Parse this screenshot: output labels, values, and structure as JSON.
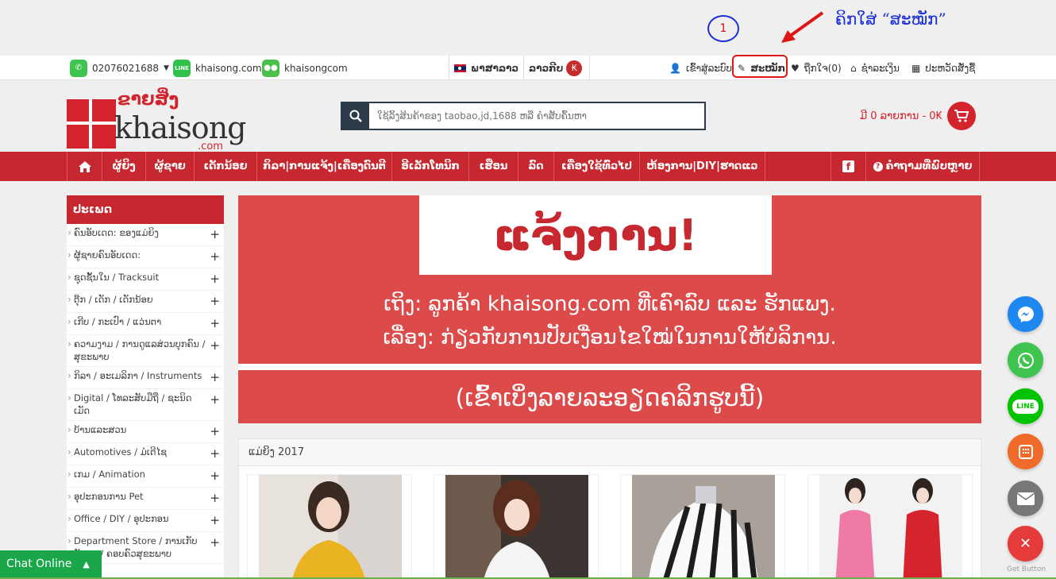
{
  "annotation": {
    "step_number": "1",
    "instruction": "ຄິກໃສ່ “ສະໝັກ”"
  },
  "topbar": {
    "phone": "02076021688",
    "line_id": "khaisong.com",
    "wechat_id": "khaisongcom",
    "language": "ພາສາລາວ",
    "currency": "ລາວກີບ",
    "currency_symbol": "₭",
    "login": "ເຂົ້າສູ່ລະບົບ",
    "register": "ສະໝັກ",
    "wishlist": "ຖືກໃຈ(0)",
    "checkout": "ຊຳລະເງິນ",
    "order_history": "ປະຫວັດສັ່ງຊື້"
  },
  "header": {
    "logo_lao": "ຂາຍສິ່ງ",
    "logo_main": "khaisong",
    "logo_com": ".com",
    "search_placeholder": "ໃຊ້ລິ້ງສິນຄ້າຂອງ taobao,jd,1688 ຫລື ຄຳສັບຄົ້ນຫາ",
    "cart_text": "ມີ 0 ລາຍການ - 0₭"
  },
  "nav": {
    "items": [
      "ຜູ້ຍິງ",
      "ຜູ້ຊາຍ",
      "ເດັກນ້ອຍ",
      "ກິລາ|ການແຈ້ງ|ເຄື່ອງດົນຕີ",
      "ອີເລັກໂທນິກ",
      "ເຮືອນ",
      "ລົດ",
      "ເຄື່ອງໃຊ້ທົ່ວໄປ",
      "ຫ້ອງການ|DIY|ຮາດແວ"
    ],
    "faq": "ຄຳຖາມທີ່ພົບຫຼາຍ"
  },
  "sidebar": {
    "title": "ປະເພດ",
    "items": [
      "ຄົນອັບເດດ: ຂອງແມ່ຍິງ",
      "ຜູ້ຊາຍຄົນອັບເດດ:",
      "ຊຸດຊັ້ນໃນ / Tracksuit",
      "ຕຸ໊ກ / ເດັກ / ເດັກນ້ອຍ",
      "ເກີບ / ກະເປົາ / ແວ່ນຕາ",
      "ຄວາມງາມ / ການດູແລສ່ວນບຸກຄົນ / ສຸຂະພາບ",
      "ກິລາ / ອະເມລິກາ / Instruments",
      "Digital / ໂທລະສັບມືຖື / ຊະນິດເມັດ",
      "ບ້ານແລະສວນ",
      "Automotives / ມໍເຕີໄຊ",
      "ເກມ / Animation",
      "ອຸປະກອນການ Pet",
      "Office / DIY / ອຸປະກອນ",
      "Department Store / ການເກັບຮັກສາ / ຄອບຄົວສຸຂະພາບ"
    ]
  },
  "banner": {
    "title": "ແຈ້ງການ!",
    "line1": "ເຖິງ: ລູກຄ້າ khaisong.com ທີ່ເຄົາລົບ ແລະ ຮັກແພງ.",
    "line2": "ເລື່ອງ: ກ່ຽວກັບການປັບເງື່ອນໄຂໃໝ່ໃນການໃຫ້ບໍລິການ.",
    "line3": "(ເຂົ້າເບິ່ງລາຍລະອຽດຄລິກຮູບນີ້)"
  },
  "products": {
    "heading": "ແມ່ຍິງ 2017",
    "count": 4
  },
  "floating": {
    "get_button": "Get Button",
    "messenger_color": "#1e88f0",
    "whatsapp_color": "#3ec44f",
    "line_color": "#00c300",
    "phone_color": "#f06a2a",
    "email_color": "#777777",
    "close_color": "#e63b3b"
  },
  "chat": {
    "label": "Chat Online"
  }
}
